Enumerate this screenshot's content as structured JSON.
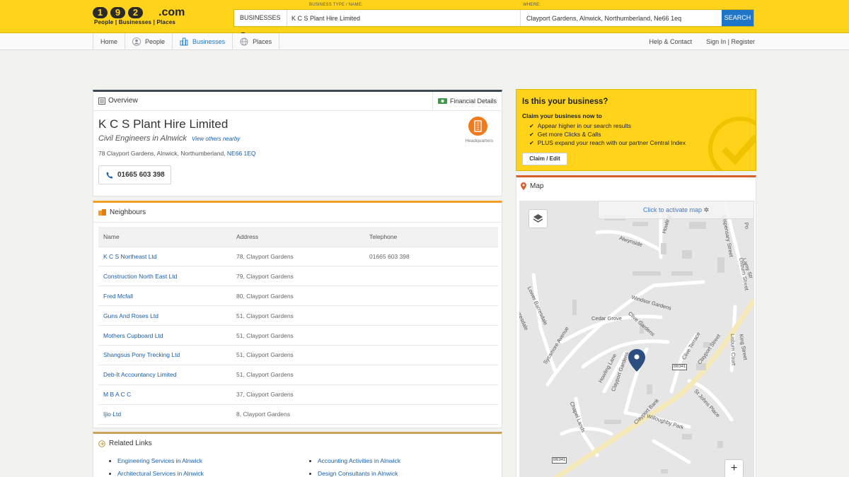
{
  "header": {
    "logo_digits": [
      "1",
      "9",
      "2"
    ],
    "logo_suffix": ".com",
    "logo_tagline": "People | Businesses | Places",
    "business_label": "BUSINESS TYPE / NAME:",
    "where_label": "WHERE:",
    "type_select": "BUSINESSES ▼",
    "name_value": "K C S Plant Hire Limited",
    "where_value": "Clayport Gardens, Alnwick, Northumberland, Ne66 1eq",
    "search_label": "SEARCH"
  },
  "nav": {
    "items": [
      {
        "label": "Home",
        "icon": "home"
      },
      {
        "label": "People",
        "icon": "people-icon"
      },
      {
        "label": "Businesses",
        "icon": "buildings-icon"
      },
      {
        "label": "Places",
        "icon": "globe-icon"
      }
    ],
    "help": "Help & Contact",
    "signin": "Sign In",
    "separator": "|",
    "register": "Register"
  },
  "overview": {
    "title": "Overview",
    "financial": "Financial Details",
    "company_name": "K C S Plant Hire Limited",
    "category": "Civil Engineers in Alnwick",
    "others_link": "View others nearby",
    "address": "78  Clayport Gardens,  Alnwick,  Northumberland,",
    "postcode": "NE66 1EQ",
    "phone": "01665 603 398",
    "hq_label": "Headquarters"
  },
  "neighbours": {
    "title": "Neighbours",
    "columns": [
      "Name",
      "Address",
      "Telephone"
    ],
    "rows": [
      {
        "name": "K C S Northeast Ltd",
        "address": "78, Clayport Gardens",
        "phone": "01665 603 398"
      },
      {
        "name": "Construction North East Ltd",
        "address": "79, Clayport Gardens",
        "phone": ""
      },
      {
        "name": "Fred Mcfall",
        "address": "80, Clayport Gardens",
        "phone": ""
      },
      {
        "name": "Guns And Roses Ltd",
        "address": "51, Clayport Gardens",
        "phone": ""
      },
      {
        "name": "Mothers Cupboard Ltd",
        "address": "51, Clayport Gardens",
        "phone": ""
      },
      {
        "name": "Shangsus Pony Trecking Ltd",
        "address": "51, Clayport Gardens",
        "phone": ""
      },
      {
        "name": "Deb-It Accountancy Limited",
        "address": "51, Clayport Gardens",
        "phone": ""
      },
      {
        "name": "M B A C C",
        "address": "37, Clayport Gardens",
        "phone": ""
      },
      {
        "name": "Ijio Ltd",
        "address": "8, Clayport Gardens",
        "phone": ""
      }
    ]
  },
  "related": {
    "title": "Related Links",
    "links": [
      "Engineering Services in Alnwick",
      "Accounting Activities in Alnwick",
      "Architectural Services in Alnwick",
      "Design Consultants in Alnwick"
    ]
  },
  "claim": {
    "title": "Is this your business?",
    "lead": "Claim your business now to",
    "points": [
      "Appear higher in our search results",
      "Get more Clicks & Calls",
      "PLUS expand your reach with our partner Central Index"
    ],
    "button": "Claim / Edit"
  },
  "map": {
    "title": "Map",
    "activate": "Click to activate map",
    "zoom_in": "+",
    "streets": [
      "Alwynside",
      "Howling",
      "Dispensary Street",
      "Lisburn Street",
      "Windsor Gardens",
      "Lower Barresdale",
      "Barresdale",
      "Clive Gardens",
      "Cedar Grove",
      "Sycamore Avenue",
      "Howling Lane",
      "Clayport Gardens",
      "Clive Terrace",
      "Clayport Street",
      "King Street",
      "Lisburn Court",
      "St Johns Place",
      "Clayport Bank",
      "Willoughby Park",
      "Chapel Lands",
      "Lamy Str",
      "Po"
    ],
    "road_codes": [
      "B6341",
      "B6341"
    ]
  }
}
